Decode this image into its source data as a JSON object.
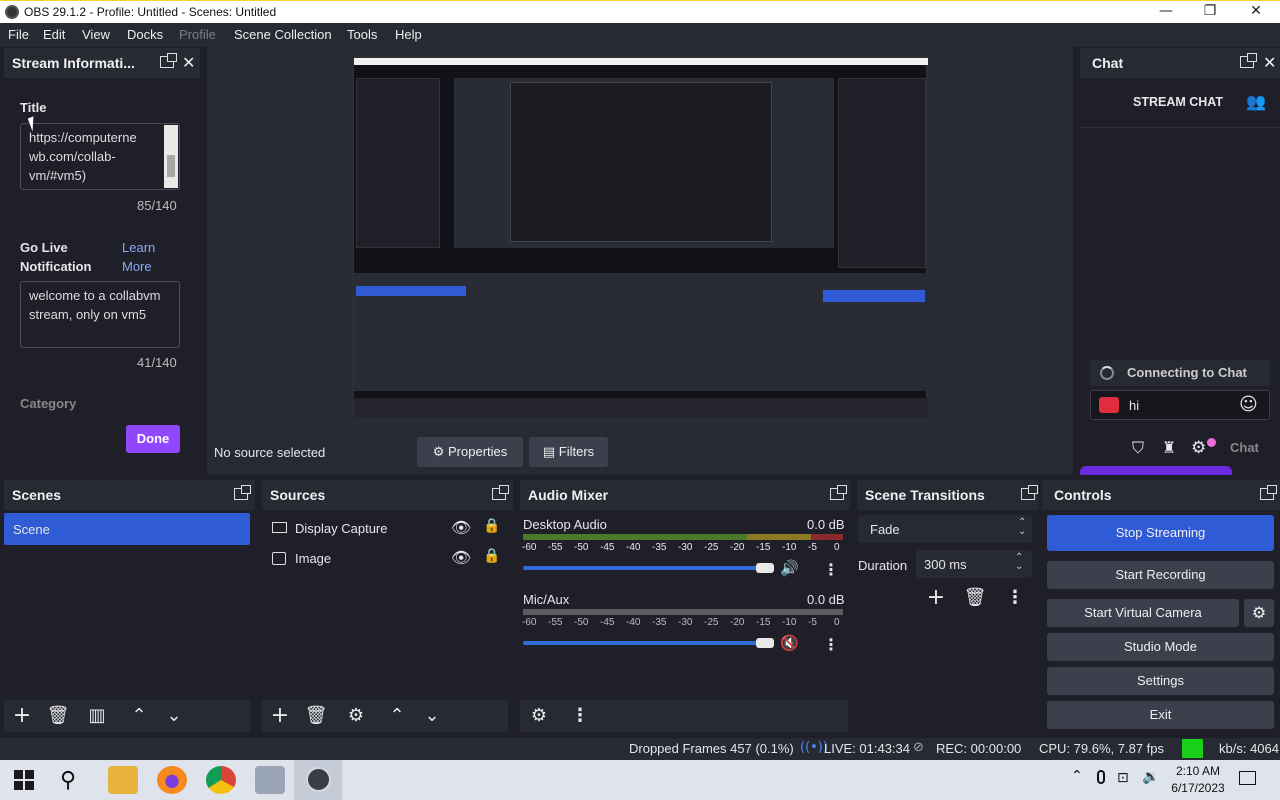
{
  "window": {
    "title": "OBS 29.1.2 - Profile: Untitled - Scenes: Untitled"
  },
  "menu": [
    "File",
    "Edit",
    "View",
    "Docks",
    "Profile",
    "Scene Collection",
    "Tools",
    "Help"
  ],
  "stream_info": {
    "header": "Stream Informati...",
    "title_label": "Title",
    "title_value": "https://computerne wb.com/collab-vm/#vm5)",
    "title_count": "85/140",
    "golive_label": "Go Live Notification",
    "learn_more": "Learn More",
    "golive_value": "welcome to a collabvm stream, only on vm5",
    "golive_count": "41/140",
    "category_label": "Category",
    "done_label": "Done"
  },
  "preview": {
    "no_source": "No source selected",
    "properties_label": "Properties",
    "filters_label": "Filters"
  },
  "chat": {
    "header": "Chat",
    "stream_chat": "STREAM CHAT",
    "connecting": "Connecting to Chat",
    "message_value": "hi",
    "chat_button": "Chat"
  },
  "scenes": {
    "header": "Scenes",
    "items": [
      "Scene"
    ]
  },
  "sources": {
    "header": "Sources",
    "items": [
      "Display Capture",
      "Image"
    ]
  },
  "mixer": {
    "header": "Audio Mixer",
    "channels": [
      {
        "name": "Desktop Audio",
        "db": "0.0 dB",
        "volume": 0.94,
        "muted": false
      },
      {
        "name": "Mic/Aux",
        "db": "0.0 dB",
        "volume": 0.94,
        "muted": true
      }
    ],
    "ticks": [
      "-60",
      "-55",
      "-50",
      "-45",
      "-40",
      "-35",
      "-30",
      "-25",
      "-20",
      "-15",
      "-10",
      "-5",
      "0"
    ]
  },
  "transitions": {
    "header": "Scene Transitions",
    "transition": "Fade",
    "duration_label": "Duration",
    "duration_value": "300 ms"
  },
  "controls": {
    "header": "Controls",
    "stop_streaming": "Stop Streaming",
    "start_recording": "Start Recording",
    "start_virtual_camera": "Start Virtual Camera",
    "studio_mode": "Studio Mode",
    "settings": "Settings",
    "exit": "Exit"
  },
  "status": {
    "dropped": "Dropped Frames 457 (0.1%)",
    "live": "LIVE: 01:43:34",
    "rec": "REC: 00:00:00",
    "cpu": "CPU: 79.6%, 7.87 fps",
    "kbs": "kb/s: 4064"
  },
  "taskbar": {
    "time": "2:10 AM",
    "date": "6/17/2023"
  },
  "colors": {
    "accent_blue": "#2f5bd6",
    "done_purple": "#9147ff",
    "status_green": "#17d017"
  }
}
